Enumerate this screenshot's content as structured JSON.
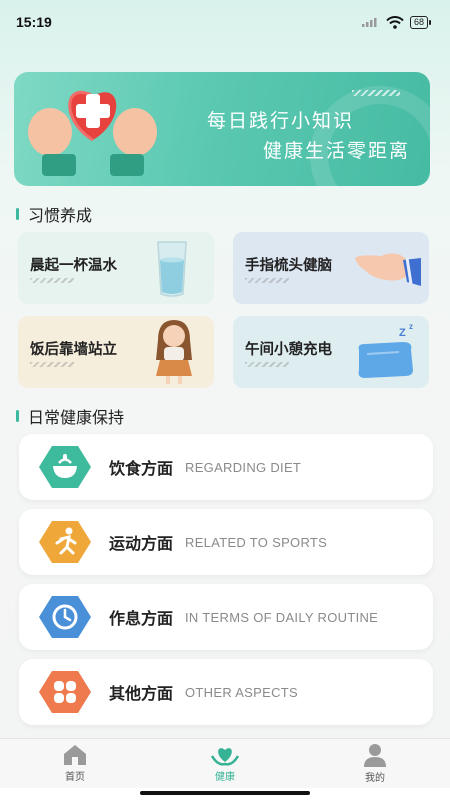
{
  "status": {
    "time": "15:19",
    "battery": "68"
  },
  "banner": {
    "line1": "每日践行小知识",
    "line2": "健康生活零距离"
  },
  "habits": {
    "title": "习惯养成",
    "items": [
      {
        "label": "晨起一杯温水",
        "icon": "water-glass-icon"
      },
      {
        "label": "手指梳头健脑",
        "icon": "hand-pointing-icon"
      },
      {
        "label": "饭后靠墙站立",
        "icon": "girl-standing-icon"
      },
      {
        "label": "午间小憩充电",
        "icon": "pillow-sleep-icon"
      }
    ]
  },
  "daily": {
    "title": "日常健康保持",
    "items": [
      {
        "name": "饮食方面",
        "en": "REGARDING DIET",
        "icon": "bowl-icon",
        "color": "#3dbb9c"
      },
      {
        "name": "运动方面",
        "en": "RELATED TO SPORTS",
        "icon": "running-icon",
        "color": "#f0a73a"
      },
      {
        "name": "作息方面",
        "en": "IN TERMS OF DAILY ROUTINE",
        "icon": "clock-icon",
        "color": "#4a90d9"
      },
      {
        "name": "其他方面",
        "en": "OTHER ASPECTS",
        "icon": "clover-icon",
        "color": "#ee7a4e"
      }
    ]
  },
  "tabs": [
    {
      "label": "首页",
      "icon": "home-icon"
    },
    {
      "label": "健康",
      "icon": "health-icon"
    },
    {
      "label": "我的",
      "icon": "profile-icon"
    }
  ],
  "accent": "#36b294"
}
